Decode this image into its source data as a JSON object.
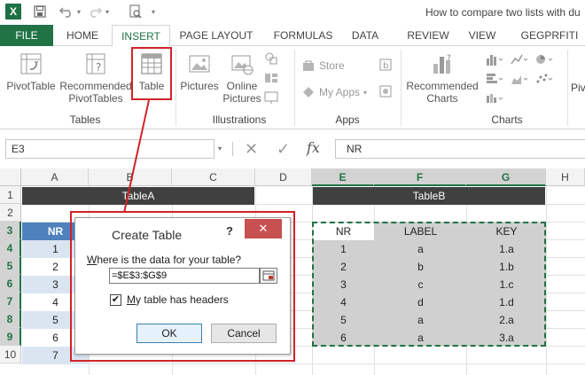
{
  "window": {
    "title": "How to compare two lists with du"
  },
  "quick_access": {
    "undo_dropdown": "▾",
    "redo_dropdown": "▾",
    "customize": "▾"
  },
  "tabs": [
    {
      "label": "FILE"
    },
    {
      "label": "HOME"
    },
    {
      "label": "INSERT"
    },
    {
      "label": "PAGE LAYOUT"
    },
    {
      "label": "FORMULAS"
    },
    {
      "label": "DATA"
    },
    {
      "label": "REVIEW"
    },
    {
      "label": "VIEW"
    },
    {
      "label": "GEGPRFITI"
    }
  ],
  "ribbon": {
    "tables": {
      "pivottable": "PivotTable",
      "recommended_line1": "Recommended",
      "recommended_line2": "PivotTables",
      "table": "Table",
      "group": "Tables"
    },
    "illustrations": {
      "pictures": "Pictures",
      "online_line1": "Online",
      "online_line2": "Pictures",
      "group": "Illustrations"
    },
    "apps": {
      "store": "Store",
      "my_apps": "My Apps",
      "group": "Apps"
    },
    "charts": {
      "recommended_line1": "Recommended",
      "recommended_line2": "Charts",
      "group": "Charts",
      "pivot_cut": "Piv"
    }
  },
  "formula_bar": {
    "name_box": "E3",
    "content": "NR",
    "name_dropdown": "▾",
    "cancel": "✕",
    "enter": "✓",
    "fx": "fx"
  },
  "sheet": {
    "columns": [
      "A",
      "B",
      "C",
      "D",
      "E",
      "F",
      "G",
      "H"
    ],
    "rows": [
      "1",
      "2",
      "3",
      "4",
      "5",
      "6",
      "7",
      "8",
      "9",
      "10"
    ],
    "tableA": {
      "banner": "TableA",
      "header_nr": "NR",
      "nr": [
        "1",
        "2",
        "3",
        "4",
        "5",
        "6",
        "7"
      ]
    },
    "tableB": {
      "banner": "TableB",
      "headers": [
        "NR",
        "LABEL",
        "KEY"
      ],
      "rows": [
        [
          "1",
          "a",
          "1.a"
        ],
        [
          "2",
          "b",
          "1.b"
        ],
        [
          "3",
          "c",
          "1.c"
        ],
        [
          "4",
          "d",
          "1.d"
        ],
        [
          "5",
          "a",
          "2.a"
        ],
        [
          "6",
          "a",
          "3.a"
        ]
      ]
    }
  },
  "dialog": {
    "title": "Create Table",
    "help": "?",
    "close": "✕",
    "prompt_underlined": "W",
    "prompt_rest": "here is the data for your table?",
    "range": "=$E$3:$G$9",
    "checkbox_mark": "✔",
    "checkbox_checked": true,
    "checkbox_underlined": "M",
    "checkbox_rest": "y table has headers",
    "ok": "OK",
    "cancel": "Cancel"
  },
  "colors": {
    "excel_green": "#217346",
    "highlight_red": "#d1232a",
    "table_header_blue": "#4f81bd",
    "banner_dark": "#404040"
  }
}
